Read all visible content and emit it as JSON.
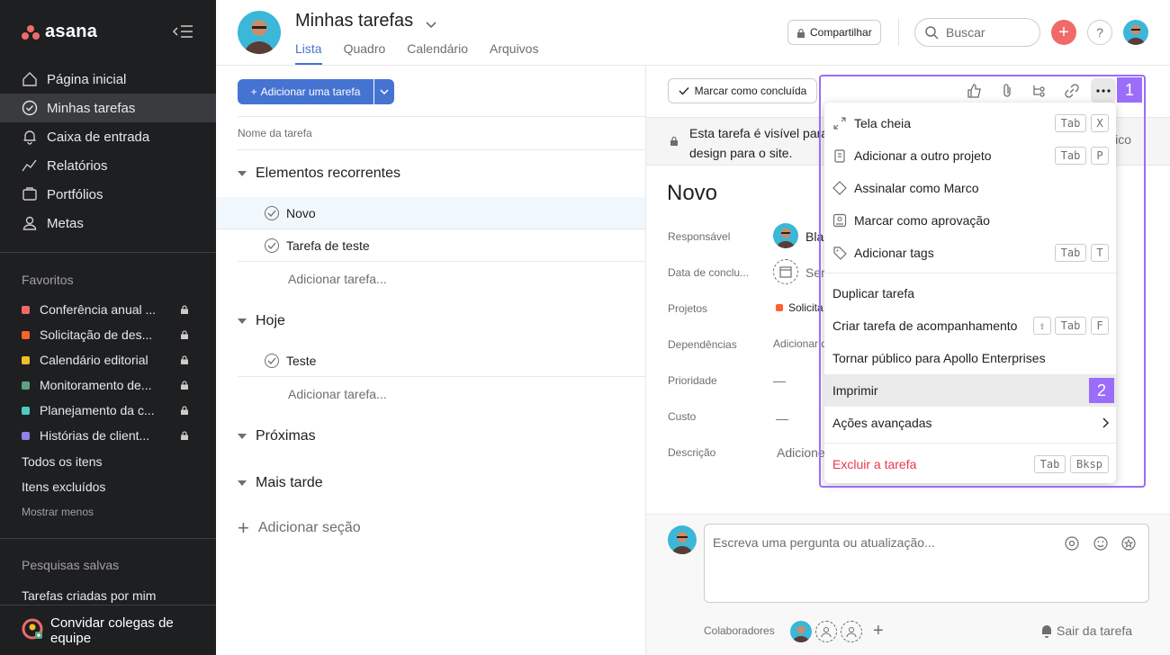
{
  "app": {
    "name": "asana"
  },
  "sidebar": {
    "nav": [
      {
        "label": "Página inicial",
        "icon": "home-icon"
      },
      {
        "label": "Minhas tarefas",
        "icon": "check-circle-icon",
        "active": true
      },
      {
        "label": "Caixa de entrada",
        "icon": "bell-icon"
      },
      {
        "label": "Relatórios",
        "icon": "trend-line-icon"
      },
      {
        "label": "Portfólios",
        "icon": "folder-icon"
      },
      {
        "label": "Metas",
        "icon": "person-icon"
      }
    ],
    "favorites_title": "Favoritos",
    "favorites": [
      {
        "label": "Conferência anual ...",
        "color": "#f06a6a"
      },
      {
        "label": "Solicitação de des...",
        "color": "#fd612c"
      },
      {
        "label": "Calendário editorial",
        "color": "#f1bd2a"
      },
      {
        "label": "Monitoramento de...",
        "color": "#5da283"
      },
      {
        "label": "Planejamento da c...",
        "color": "#4ecbc4"
      },
      {
        "label": "Histórias de client...",
        "color": "#8d84e8"
      }
    ],
    "all_items": "Todos os itens",
    "deleted_items": "Itens excluídos",
    "show_less": "Mostrar menos",
    "saved_searches_title": "Pesquisas salvas",
    "saved_search": "Tarefas criadas por mim",
    "invite": "Convidar colegas de equipe"
  },
  "header": {
    "title": "Minhas tarefas",
    "tabs": [
      "Lista",
      "Quadro",
      "Calendário",
      "Arquivos"
    ],
    "share": "Compartilhar",
    "search_placeholder": "Buscar",
    "help": "?"
  },
  "list": {
    "add_task": "Adicionar uma tarefa",
    "column_header": "Nome da tarefa",
    "sections": [
      {
        "name": "Elementos recorrentes"
      },
      {
        "name": "Hoje"
      },
      {
        "name": "Próximas"
      },
      {
        "name": "Mais tarde"
      }
    ],
    "tasks": [
      "Novo",
      "Tarefa de teste",
      "Teste"
    ],
    "add_task_inline": "Adicionar tarefa...",
    "add_section": "Adicionar seção"
  },
  "detail": {
    "mark_complete": "Marcar como concluída",
    "visibility_text": "Esta tarefa é visível para design para o site.",
    "visibility_line1": "Esta tarefa é visível para",
    "visibility_line2": "design para o site.",
    "visibility_right": "lico",
    "task_title": "Novo",
    "fields": [
      {
        "label": "Responsável",
        "value": "Blak"
      },
      {
        "label": "Data de conclu...",
        "value": "Sem"
      },
      {
        "label": "Projetos",
        "value": "Solicita"
      },
      {
        "label": "Dependências",
        "value": "Adicionar d"
      },
      {
        "label": "Prioridade",
        "value": "—"
      },
      {
        "label": "Custo",
        "value": "—"
      },
      {
        "label": "Descrição",
        "value": "Adicione"
      }
    ],
    "comment_placeholder": "Escreva uma pergunta ou atualização...",
    "collaborators": "Colaboradores",
    "leave_task": "Sair da tarefa"
  },
  "menu": {
    "items": [
      {
        "label": "Tela cheia",
        "icon": "expand-icon",
        "keys": [
          "Tab",
          "X"
        ]
      },
      {
        "label": "Adicionar a outro projeto",
        "icon": "clipboard-icon",
        "keys": [
          "Tab",
          "P"
        ]
      },
      {
        "label": "Assinalar como Marco",
        "icon": "diamond-icon",
        "keys": []
      },
      {
        "label": "Marcar como aprovação",
        "icon": "approval-icon",
        "keys": []
      },
      {
        "label": "Adicionar tags",
        "icon": "tag-icon",
        "keys": [
          "Tab",
          "T"
        ]
      },
      {
        "label": "Duplicar tarefa",
        "keys": []
      },
      {
        "label": "Criar tarefa de acompanhamento",
        "keys": [
          "⇧",
          "Tab",
          "F"
        ]
      },
      {
        "label": "Tornar público para Apollo Enterprises",
        "keys": []
      },
      {
        "label": "Imprimir",
        "keys": [],
        "highlighted": true
      },
      {
        "label": "Ações avançadas",
        "keys": [],
        "submenu": true
      },
      {
        "label": "Excluir a tarefa",
        "keys": [
          "Tab",
          "Bksp"
        ],
        "danger": true
      }
    ]
  },
  "annotations": {
    "badge1": "1",
    "badge2": "2",
    "color": "#9b6dfa"
  }
}
